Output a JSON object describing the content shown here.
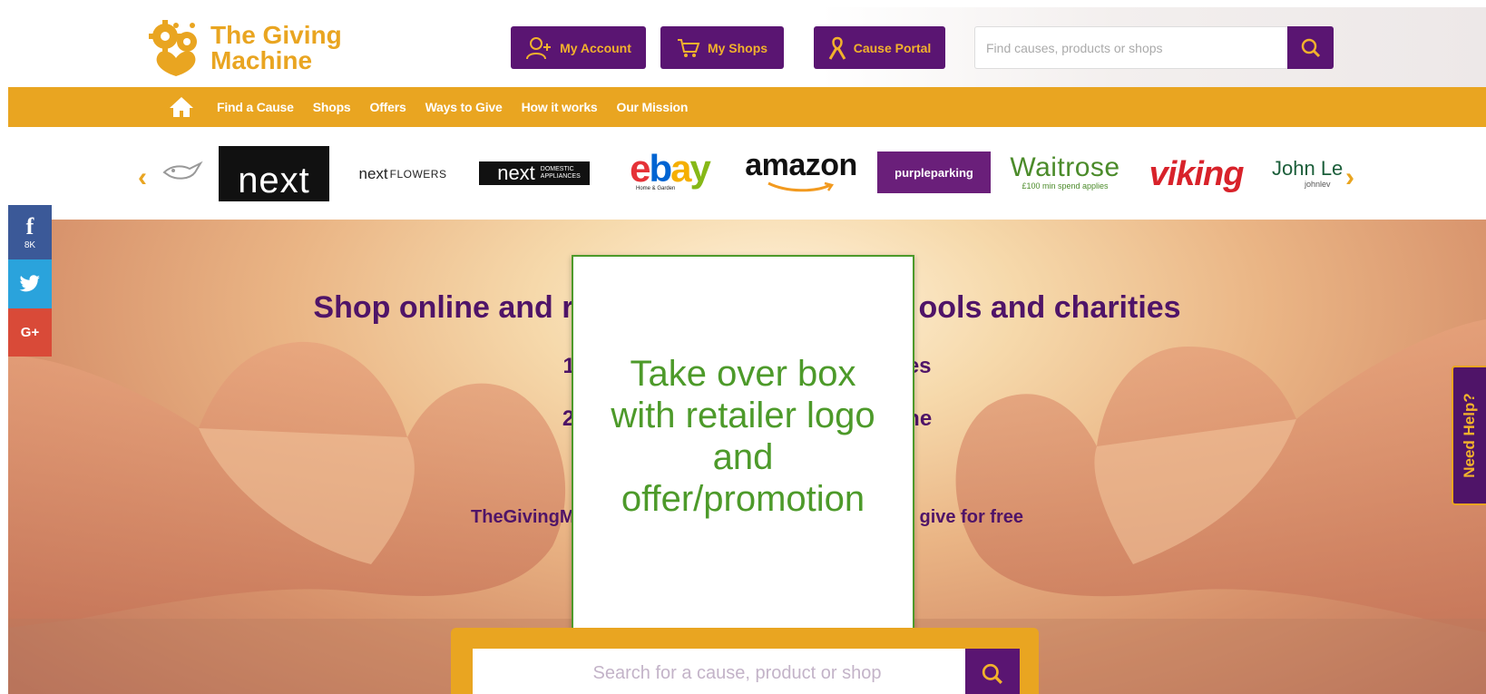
{
  "header": {
    "logo": {
      "line1": "The Giving",
      "line2": "Machine"
    },
    "buttons": {
      "account": "My Account",
      "shops": "My Shops",
      "cause": "Cause Portal"
    },
    "search": {
      "placeholder": "Find causes, products or shops"
    }
  },
  "nav": {
    "items": [
      "Find a Cause",
      "Shops",
      "Offers",
      "Ways to Give",
      "How it works",
      "Our Mission"
    ]
  },
  "retailers": {
    "next": "next",
    "next_flowers_main": "next",
    "next_flowers_sub": "FLOWERS",
    "next_appliances_main": "next",
    "next_appliances_sub": "DOMESTIC APPLIANCES",
    "ebay": "ebay",
    "ebay_sub": "Home & Garden",
    "amazon": "amazon",
    "purpleparking": "purpleparking",
    "waitrose": "Waitrose",
    "waitrose_sub": "£100 min spend applies",
    "viking": "viking",
    "john_lewis": "John Le",
    "john_lewis_sub": "johnlev"
  },
  "hero": {
    "headline_left": "Shop online and r",
    "headline_right": "ools and charities",
    "step1_left": "1)",
    "step1_right": "es",
    "step2_left": "2)",
    "step2_right": "ne",
    "tagline_left": "TheGivingM",
    "tagline_right": "give for free",
    "takeover_text": "Take over box with retailer logo and offer/promotion",
    "search_placeholder": "Search for a cause, product or shop"
  },
  "social": {
    "facebook_count": "8K",
    "gplus": "G+"
  },
  "help": {
    "label": "Need Help?"
  },
  "colors": {
    "purple": "#5a1572",
    "gold": "#e9a521",
    "takeover_green": "#4d9a2a"
  }
}
